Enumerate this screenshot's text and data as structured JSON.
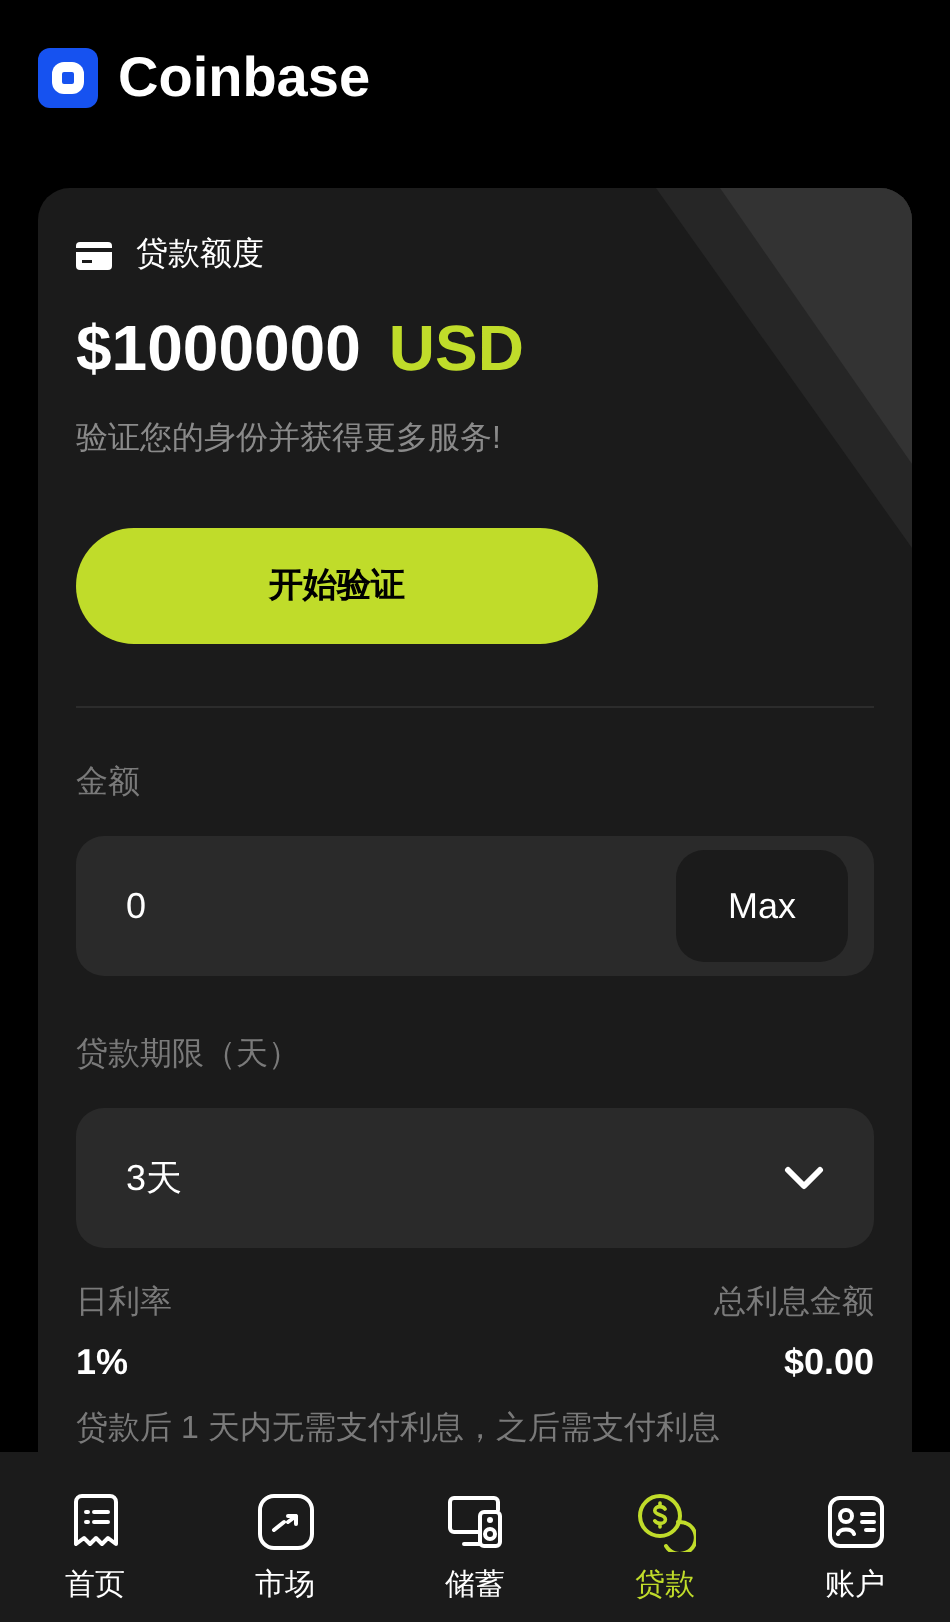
{
  "header": {
    "brand": "Coinbase"
  },
  "credit": {
    "title": "贷款额度",
    "amount": "$1000000",
    "currency": "USD",
    "subtitle": "验证您的身份并获得更多服务!",
    "verify_button": "开始验证"
  },
  "amount_field": {
    "label": "金额",
    "value": "0",
    "max_button": "Max"
  },
  "term_field": {
    "label": "贷款期限（天）",
    "value": "3天"
  },
  "stats": [
    {
      "label": "日利率",
      "value": "1%"
    },
    {
      "label": "总利息金额",
      "value": "$0.00"
    }
  ],
  "note": "贷款后 1 天内无需支付利息，之后需支付利息",
  "nav": [
    {
      "label": "首页",
      "kind": "home",
      "selected": false
    },
    {
      "label": "市场",
      "kind": "market",
      "selected": false
    },
    {
      "label": "储蓄",
      "kind": "savings",
      "selected": false
    },
    {
      "label": "贷款",
      "kind": "loan",
      "selected": true
    },
    {
      "label": "账户",
      "kind": "account",
      "selected": false
    }
  ]
}
